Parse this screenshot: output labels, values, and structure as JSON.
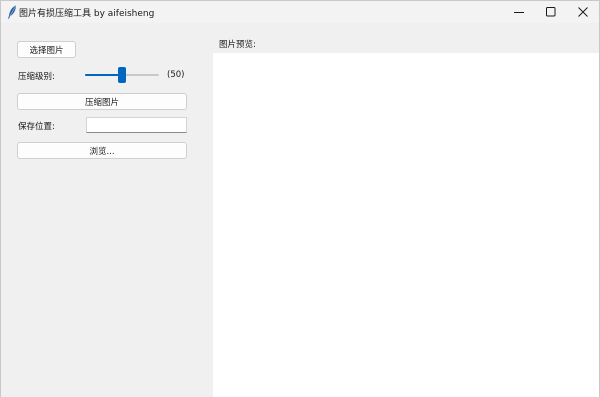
{
  "window": {
    "title": "图片有损压缩工具 by aifeisheng",
    "app_icon": "feather-icon"
  },
  "controls": {
    "select_button": "选择图片",
    "level_label": "压缩级别:",
    "level_value": 50,
    "level_display": "(50)",
    "level_min": 0,
    "level_max": 100,
    "compress_button": "压缩图片",
    "save_label": "保存位置:",
    "save_path": "",
    "browse_button": "浏览..."
  },
  "preview": {
    "label": "图片预览:"
  },
  "colors": {
    "accent": "#0067c0",
    "background": "#f0f0f0",
    "preview_bg": "#ffffff"
  }
}
